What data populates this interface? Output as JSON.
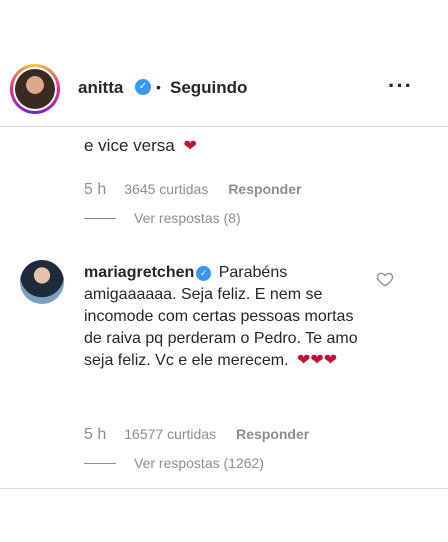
{
  "header": {
    "username": "anitta",
    "verified_icon": "verified-check-icon",
    "separator": "•",
    "follow_status": "Seguindo",
    "more_icon": "more-options-icon",
    "more_glyph": "···"
  },
  "comments": [
    {
      "text": "e vice versa",
      "emoji": "❤",
      "time": "5 h",
      "likes": "3645 curtidas",
      "reply_label": "Responder",
      "view_replies": "Ver respostas (8)"
    },
    {
      "username": "mariagretchen",
      "verified_glyph": "✓",
      "text": "Parabéns amigaaaaaa. Seja feliz. E nem se incomode com certas pessoas mortas de raiva pq perderam o Pedro. Te amo seja feliz. Vc e ele merecem.",
      "emoji": "❤❤❤",
      "time": "5 h",
      "likes": "16577 curtidas",
      "reply_label": "Responder",
      "view_replies": "Ver respostas (1262)",
      "like_icon": "heart-outline-icon"
    }
  ],
  "colors": {
    "text": "#262626",
    "muted": "#8e8e8e",
    "verified": "#3897f0",
    "heart_emoji": "#c0152f"
  }
}
